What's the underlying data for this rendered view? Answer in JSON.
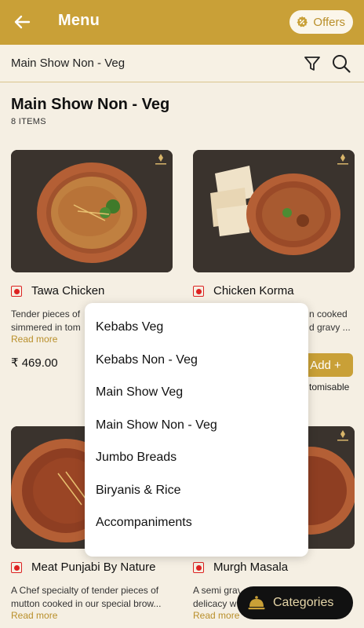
{
  "header": {
    "title": "Menu",
    "offers_label": "Offers"
  },
  "subbar": {
    "title": "Main Show Non - Veg"
  },
  "section": {
    "title": "Main Show Non - Veg",
    "count": "8 ITEMS"
  },
  "items": [
    {
      "name": "Tawa Chicken",
      "desc_line1": "Tender pieces of",
      "desc_line2": "simmered in tom",
      "read_more": "Read more",
      "price": "₹ 469.00"
    },
    {
      "name": "Chicken Korma",
      "desc_line1": "n cooked",
      "desc_line2": "d gravy ...",
      "add_label": "Add +",
      "customisable": "tomisable"
    },
    {
      "name": "Meat Punjabi By Nature",
      "desc_line1": "A Chef specialty of tender pieces of",
      "desc_line2": "mutton cooked in our special brow...",
      "read_more": "Read more"
    },
    {
      "name": "Murgh Masala",
      "desc_line1": "A semi grav",
      "desc_line2": "delicacy w",
      "read_more": "Read more"
    }
  ],
  "categories_menu": {
    "items": [
      "Kebabs Veg",
      "Kebabs Non - Veg",
      "Main Show Veg",
      "Main Show Non - Veg",
      "Jumbo Breads",
      "Biryanis & Rice",
      "Accompaniments"
    ]
  },
  "categories_button": {
    "label": "Categories"
  },
  "colors": {
    "accent": "#c9a037",
    "background": "#f5efe3",
    "nonveg": "#dd2222"
  }
}
